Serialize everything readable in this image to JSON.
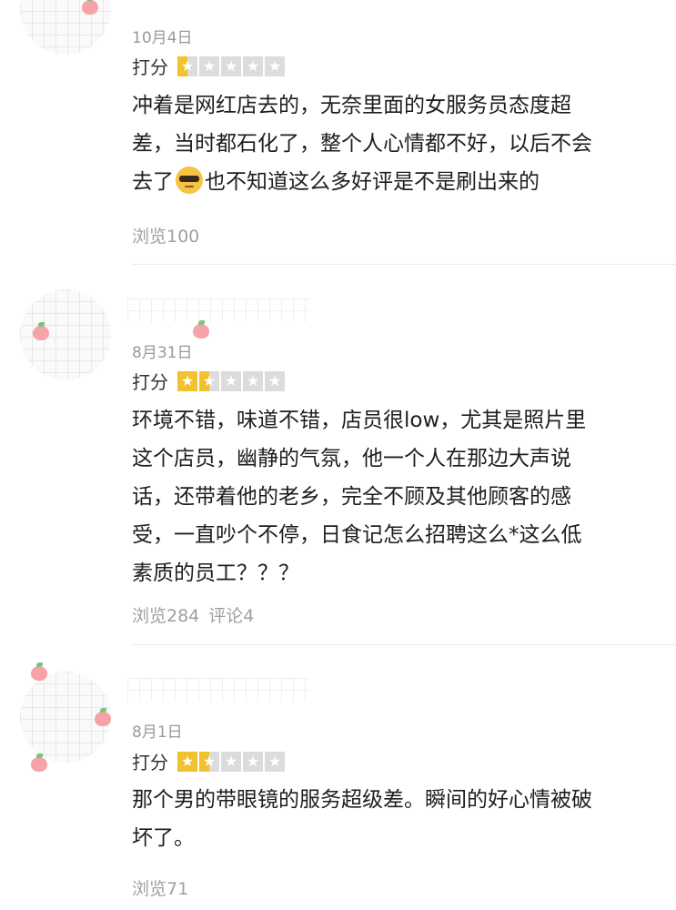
{
  "reviews": [
    {
      "date": "10月4日",
      "rating_label": "打分",
      "stars": 1,
      "text_before_emoji": "冲着是网红店去的，无奈里面的女服务员态度超\n差，当时都石化了，整个人心情都不好，以后不会\n去了",
      "emoji": "cool-face-emoji",
      "text_after_emoji": "也不知道这么多好评是不是刷出来的",
      "views": "浏览100",
      "comments": ""
    },
    {
      "date": "8月31日",
      "rating_label": "打分",
      "stars": 1.5,
      "text": "环境不错，味道不错，店员很low，尤其是照片里\n这个店员，幽静的气氛，他一个人在那边大声说\n话，还带着他的老乡，完全不顾及其他顾客的感\n受，一直吵个不停，日食记怎么招聘这么*这么低\n素质的员工？？？",
      "views": "浏览284",
      "comments": "评论4"
    },
    {
      "date": "8月1日",
      "rating_label": "打分",
      "stars": 1.5,
      "text": "那个男的带眼镜的服务超级差。瞬间的好心情被破\n坏了。",
      "views": "浏览71",
      "comments": ""
    }
  ],
  "colors": {
    "star_on": "#f2c12e",
    "star_off": "#dcdcdc",
    "meta_text": "#a0a0a0",
    "date_text": "#999999"
  }
}
